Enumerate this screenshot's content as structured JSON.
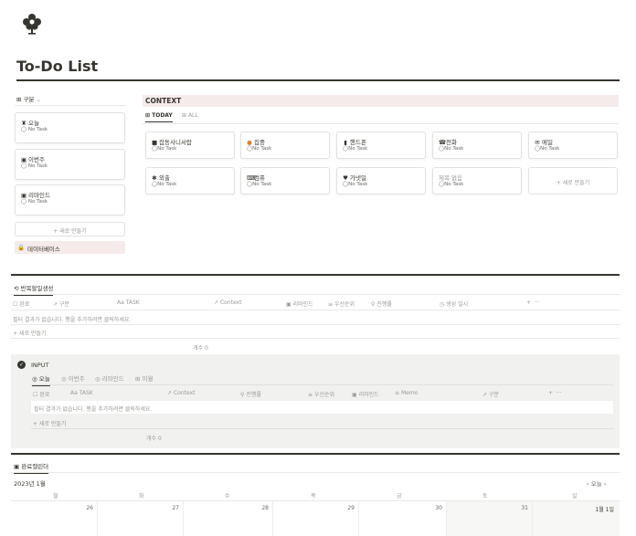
{
  "page": {
    "title": "To-Do List",
    "icon": "flower-icon"
  },
  "left_panel": {
    "view_label": "구분",
    "items": [
      {
        "label": "오늘",
        "icon": "trophy-icon",
        "sub": "No Task"
      },
      {
        "label": "이번주",
        "icon": "calendar-icon",
        "sub": "No Task"
      },
      {
        "label": "리마인드",
        "icon": "calendar-icon",
        "sub": "No Task"
      }
    ],
    "new_label": "+ 새로 만들기",
    "db_label": "데이터베이스"
  },
  "context": {
    "title": "CONTEXT",
    "tabs": [
      "TODAY",
      "ALL"
    ],
    "cards": [
      {
        "label": "잡동사니서랍",
        "sub": "No Task"
      },
      {
        "label": "집중",
        "sub": "No Task"
      },
      {
        "label": "핸드폰",
        "sub": "No Task"
      },
      {
        "label": "전화",
        "sub": "No Task"
      },
      {
        "label": "메일",
        "sub": "No Task"
      },
      {
        "label": "외출",
        "sub": "No Task"
      },
      {
        "label": "컴퓨",
        "sub": "No Task"
      },
      {
        "label": "가넷일",
        "sub": "No Task"
      },
      {
        "label": "제목 없음",
        "sub": "No Task"
      }
    ],
    "new_label": "+ 새로 만들기"
  },
  "recurring": {
    "tab_label": "반복할일생성",
    "columns": [
      "완료",
      "구분",
      "Aa TASK",
      "Context",
      "리마인드",
      "우선순위",
      "진행률",
      "생성 일시"
    ],
    "empty_text": "필터 결과가 없습니다. 행을 추가하려면 클릭하세요.",
    "new_label": "+ 새로 만들기",
    "count_label": "개수 0"
  },
  "input": {
    "title": "INPUT",
    "tabs": [
      "오늘",
      "이번주",
      "리마인드",
      "이월"
    ],
    "columns": [
      "완료",
      "Aa TASK",
      "Context",
      "진행률",
      "우선순위",
      "리마인드",
      "Memo",
      "구분"
    ],
    "empty_text": "필터 결과가 없습니다. 행을 추가하려면 클릭하세요.",
    "new_label": "+ 새로 만들기",
    "count_label": "개수 0"
  },
  "calendar": {
    "tab_label": "완료캘린더",
    "month": "2023년 1월",
    "today_label": "오늘",
    "days": [
      "월",
      "화",
      "수",
      "목",
      "금",
      "토",
      "일"
    ],
    "dates": [
      "26",
      "27",
      "28",
      "29",
      "30",
      "31",
      "1월 1일"
    ]
  }
}
